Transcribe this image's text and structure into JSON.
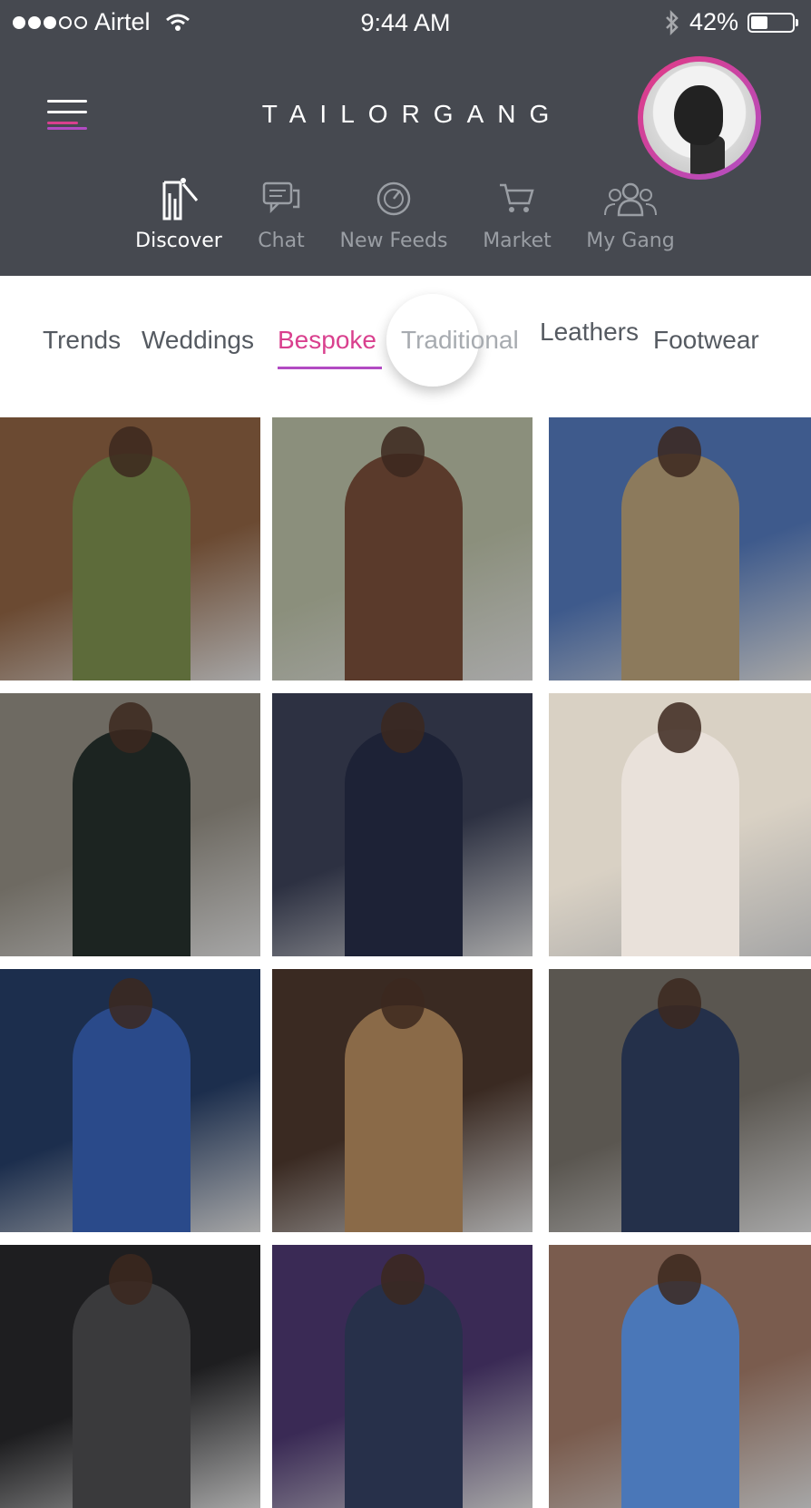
{
  "status_bar": {
    "carrier": "Airtel",
    "time": "9:44 AM",
    "battery_percent": "42%",
    "battery_level": 0.42,
    "signal_bars": 3,
    "signal_total": 5
  },
  "header": {
    "brand": "TAILORGANG",
    "menu_icon": "hamburger-icon",
    "avatar_alt": "profile-avatar"
  },
  "nav_tabs": [
    {
      "label": "Discover",
      "icon": "hanger-icon",
      "active": true
    },
    {
      "label": "Chat",
      "icon": "chat-icon",
      "active": false
    },
    {
      "label": "New Feeds",
      "icon": "feed-icon",
      "active": false
    },
    {
      "label": "Market",
      "icon": "cart-icon",
      "active": false
    },
    {
      "label": "My Gang",
      "icon": "group-icon",
      "active": false
    }
  ],
  "categories": [
    {
      "label": "Trends",
      "active": false
    },
    {
      "label": "Weddings",
      "active": false
    },
    {
      "label": "Bespoke",
      "active": true
    },
    {
      "label": "Traditional",
      "active": false
    },
    {
      "label": "Leathers",
      "active": false
    },
    {
      "label": "Footwear",
      "active": false
    }
  ],
  "colors": {
    "header_bg": "#464950",
    "accent_pink": "#d9408e",
    "accent_purple": "#b24bc3",
    "tab_active": "#ffffff",
    "tab_inactive": "#9a9ea4"
  },
  "gallery": [
    {
      "name": "green-tweed-vest",
      "bg": "#6b4a32",
      "fig": "#5d6b3a"
    },
    {
      "name": "brown-tweed-jacket",
      "bg": "#8b8f7c",
      "fig": "#5a3a2b"
    },
    {
      "name": "fabric-flatlay",
      "bg": "#3e5a8c",
      "fig": "#8c7a5c"
    },
    {
      "name": "velvet-double-breasted",
      "bg": "#6e6a62",
      "fig": "#1c2421"
    },
    {
      "name": "navy-suit-seated",
      "bg": "#2d3142",
      "fig": "#1d2236"
    },
    {
      "name": "wedding-couple",
      "bg": "#d9d1c4",
      "fig": "#e9e1da"
    },
    {
      "name": "navy-morning-suit",
      "bg": "#1c2e4d",
      "fig": "#2a4a8a"
    },
    {
      "name": "camel-tweed-jacket",
      "bg": "#3a2a22",
      "fig": "#8a6a48"
    },
    {
      "name": "street-blazer",
      "bg": "#5a5650",
      "fig": "#24304a"
    },
    {
      "name": "tailor-measuring",
      "bg": "#1e1e20",
      "fig": "#3a3a3c"
    },
    {
      "name": "runway-suit",
      "bg": "#3a2a55",
      "fig": "#27304a"
    },
    {
      "name": "blue-pattern-suit",
      "bg": "#7a5c4e",
      "fig": "#4a77b8"
    }
  ]
}
